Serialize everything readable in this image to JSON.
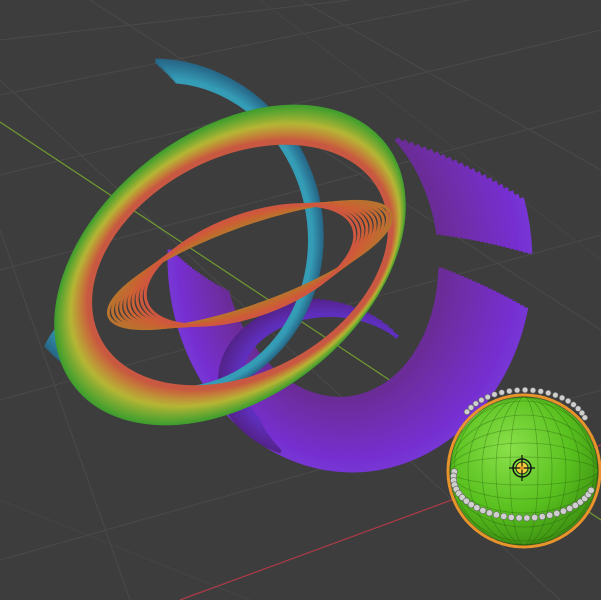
{
  "viewport": {
    "background": "#3d3d3d",
    "grid_color": "#4a4a4a",
    "axis_x_color": "#c0404f",
    "axis_y_color": "#7aa33a"
  },
  "torus_knot": {
    "colors": [
      "#2f7fb0",
      "#8a3fd0",
      "#48c83a",
      "#d6685c",
      "#b29a3a"
    ]
  },
  "sphere": {
    "selected": true,
    "fill_color": "#5ac81e",
    "outline_color": "#e8942a"
  },
  "origin_icon": "origin-icon"
}
